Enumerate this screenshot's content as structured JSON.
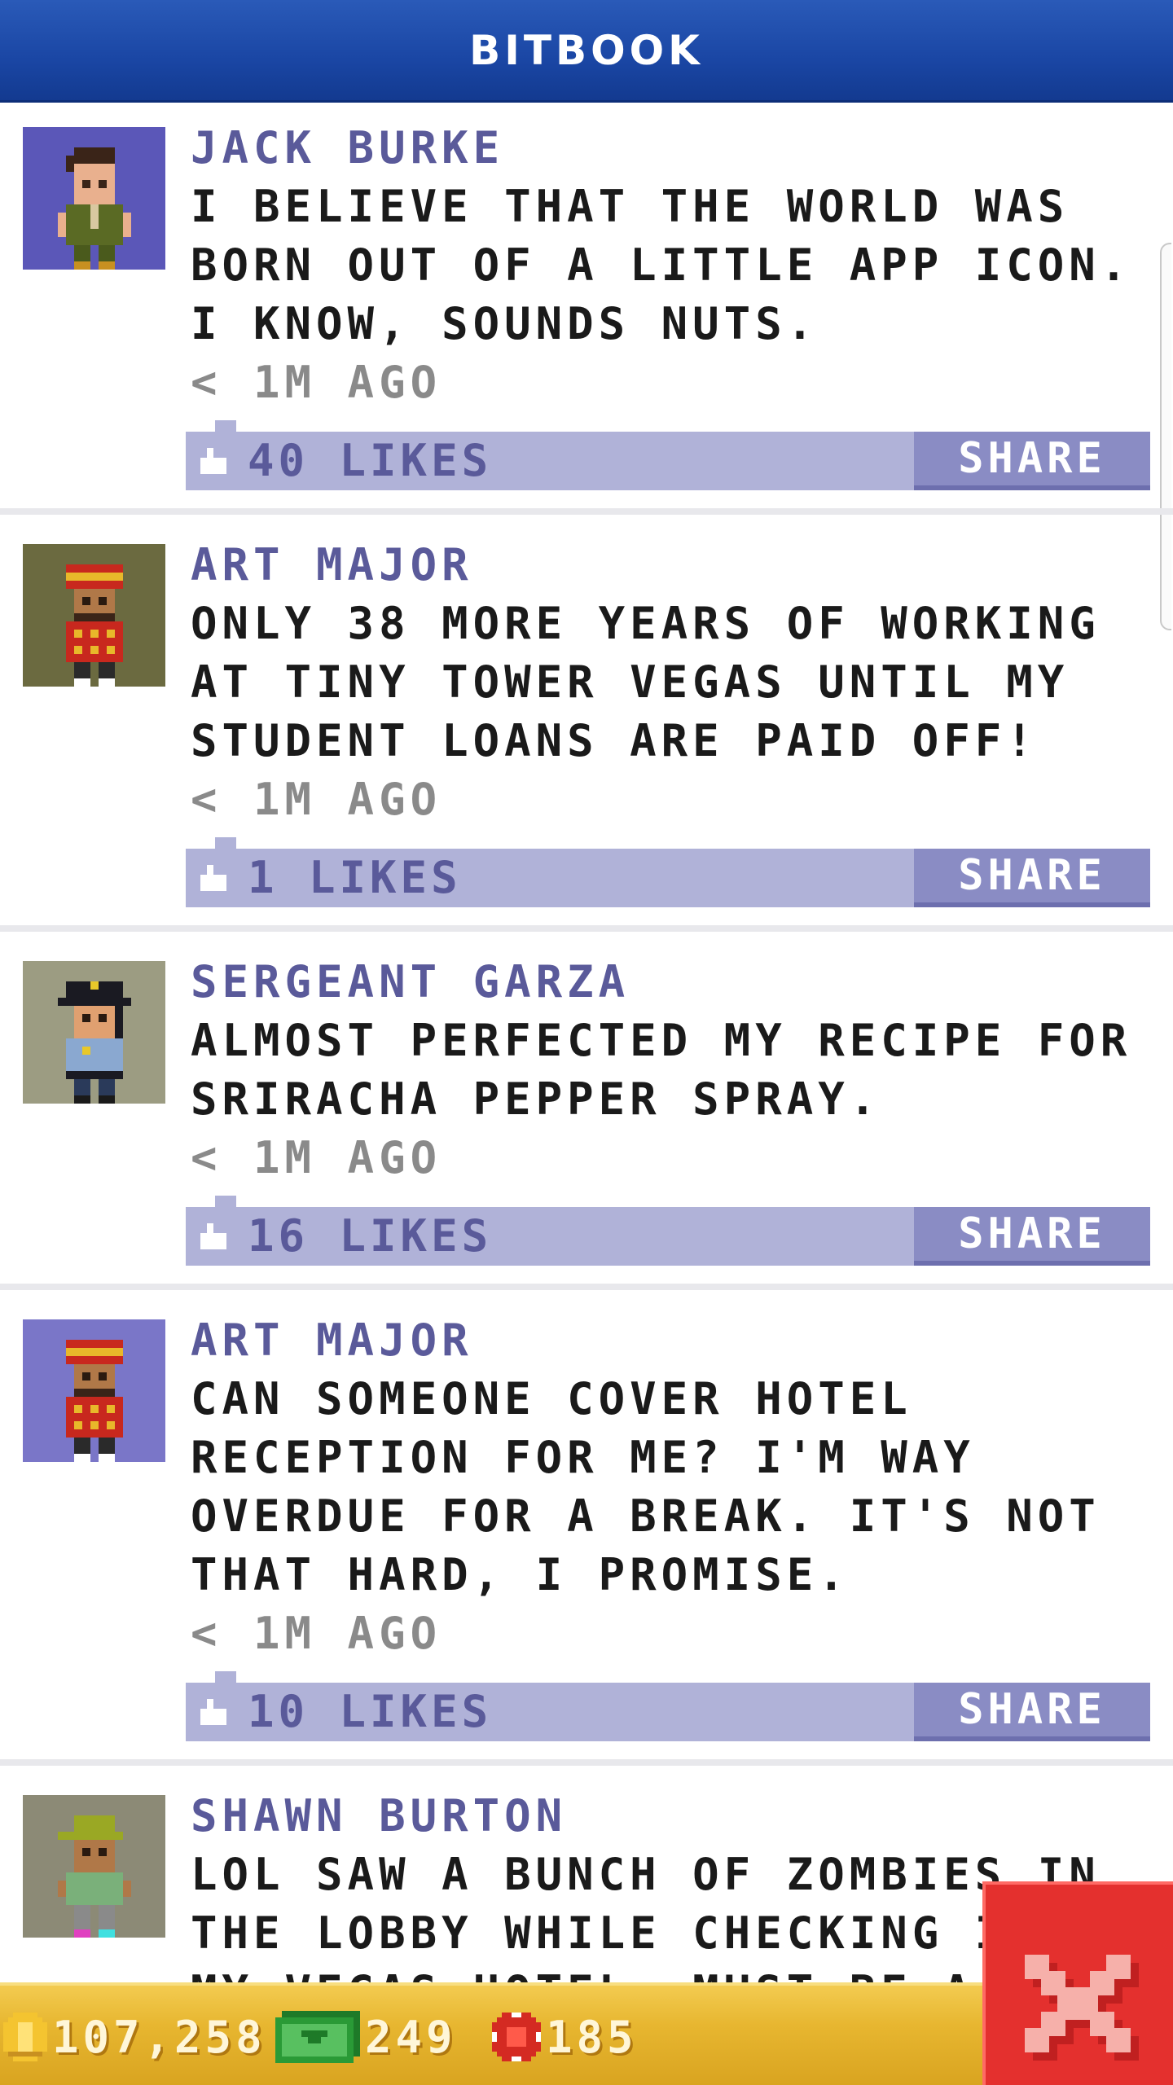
{
  "app": {
    "title": "BITBOOK"
  },
  "posts": [
    {
      "name": "JACK BURKE",
      "message": "I BELIEVE THAT THE WORLD WAS BORN OUT OF A LITTLE APP ICON. I KNOW, SOUNDS NUTS.",
      "time": "< 1M AGO",
      "likes": "40 LIKES",
      "share": "SHARE",
      "avatar_bg": "#5b57b8",
      "avatar_icon": "man-green-suit-avatar"
    },
    {
      "name": "ART MAJOR",
      "message": "ONLY 38 MORE YEARS OF WORKING AT TINY TOWER VEGAS UNTIL MY STUDENT LOANS ARE PAID OFF!",
      "time": "< 1M AGO",
      "likes": "1 LIKES",
      "share": "SHARE",
      "avatar_bg": "#6b6a40",
      "avatar_icon": "bellhop-avatar"
    },
    {
      "name": "SERGEANT GARZA",
      "message": "ALMOST PERFECTED MY RECIPE FOR SRIRACHA PEPPER SPRAY.",
      "time": "< 1M AGO",
      "likes": "16 LIKES",
      "share": "SHARE",
      "avatar_bg": "#9c9c82",
      "avatar_icon": "police-officer-avatar"
    },
    {
      "name": "ART MAJOR",
      "message": "CAN SOMEONE COVER HOTEL RECEPTION FOR ME? I'M WAY OVERDUE FOR A BREAK. IT'S NOT THAT HARD, I PROMISE.",
      "time": "< 1M AGO",
      "likes": "10 LIKES",
      "share": "SHARE",
      "avatar_bg": "#7a76c8",
      "avatar_icon": "bellhop-avatar"
    },
    {
      "name": "SHAWN BURTON",
      "message": "LOL SAW A BUNCH OF ZOMBIES IN THE LOBBY WHILE CHECKING INTO MY VEGAS HOTEL. MUST BE A FLASH",
      "time": "",
      "likes": "",
      "share": "",
      "avatar_bg": "#8c8a76",
      "avatar_icon": "green-cap-avatar"
    }
  ],
  "status_bar": {
    "coins": "107,258",
    "bux": "249",
    "tokens": "185"
  },
  "colors": {
    "header_blue": "#1a46a4",
    "like_bar": "#b0b2d8",
    "share_button": "#8a8cc4",
    "name_text": "#5a5a9a",
    "close_button": "#e4302e"
  }
}
